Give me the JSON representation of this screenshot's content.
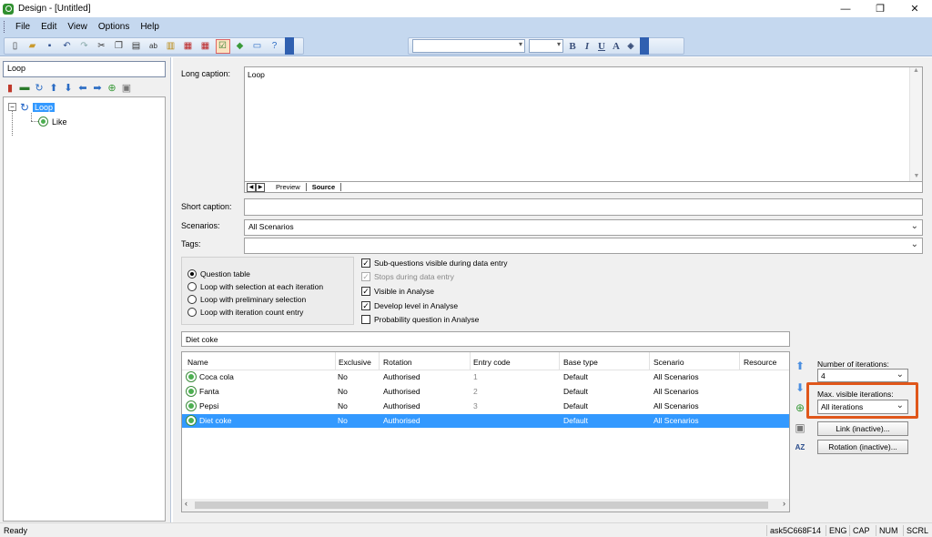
{
  "window": {
    "title": "Design - [Untitled]"
  },
  "window_controls": {
    "minimize": "—",
    "maximize": "❐",
    "close": "✕"
  },
  "menu": [
    "File",
    "Edit",
    "View",
    "Options",
    "Help"
  ],
  "left": {
    "search_value": "Loop",
    "tree": {
      "root_label": "Loop",
      "child_label": "Like"
    }
  },
  "editor": {
    "long_caption_label": "Long caption:",
    "long_caption_value": "Loop",
    "tabs": [
      "Preview",
      "Source"
    ],
    "short_caption_label": "Short caption:",
    "short_caption_value": "",
    "scenarios_label": "Scenarios:",
    "scenarios_value": "All Scenarios",
    "tags_label": "Tags:",
    "tags_value": ""
  },
  "loop_type": {
    "options": [
      "Question table",
      "Loop with selection at each iteration",
      "Loop with preliminary selection",
      "Loop with iteration count entry"
    ],
    "selected_index": 0
  },
  "flags": [
    {
      "label": "Sub-questions visible during data entry",
      "checked": true,
      "enabled": true
    },
    {
      "label": "Stops during data entry",
      "checked": true,
      "enabled": false
    },
    {
      "label": "Visible in Analyse",
      "checked": true,
      "enabled": true
    },
    {
      "label": "Develop level in Analyse",
      "checked": true,
      "enabled": true
    },
    {
      "label": "Probability question in Analyse",
      "checked": false,
      "enabled": true
    }
  ],
  "category_field": "Diet coke",
  "grid": {
    "columns": [
      "Name",
      "Exclusive",
      "Rotation",
      "Entry code",
      "Base type",
      "Scenario",
      "Resource"
    ],
    "rows": [
      {
        "name": "Coca cola",
        "exclusive": "No",
        "rotation": "Authorised",
        "code": "1",
        "base": "Default",
        "scenario": "All Scenarios"
      },
      {
        "name": "Fanta",
        "exclusive": "No",
        "rotation": "Authorised",
        "code": "2",
        "base": "Default",
        "scenario": "All Scenarios"
      },
      {
        "name": "Pepsi",
        "exclusive": "No",
        "rotation": "Authorised",
        "code": "3",
        "base": "Default",
        "scenario": "All Scenarios"
      },
      {
        "name": "Diet coke",
        "exclusive": "No",
        "rotation": "Authorised",
        "code": "",
        "base": "Default",
        "scenario": "All Scenarios"
      }
    ],
    "selected_row": 3
  },
  "iterations": {
    "count_label": "Number of iterations:",
    "count_value": "4",
    "max_visible_label": "Max. visible iterations:",
    "max_visible_value": "All iterations",
    "link_button": "Link (inactive)...",
    "rotation_button": "Rotation (inactive)..."
  },
  "status": {
    "left": "Ready",
    "id": "ask5C668F14",
    "lang": "ENG",
    "caps": "CAP",
    "num": "NUM",
    "scrl": "SCRL"
  },
  "colors": {
    "menubar": "#c5d8ef",
    "selection": "#3399ff",
    "highlight": "#e0571b"
  },
  "icons": [
    "app-icon",
    "new-icon",
    "open-icon",
    "save-icon",
    "undo-icon",
    "redo-icon",
    "cut-icon",
    "copy-icon",
    "paste-icon",
    "spellcheck-icon",
    "calendar-icon",
    "check-icon",
    "diamond-icon",
    "monitor-icon",
    "help-icon",
    "bold-icon",
    "italic-icon",
    "underline-icon",
    "font-color-icon",
    "fill-color-icon"
  ]
}
